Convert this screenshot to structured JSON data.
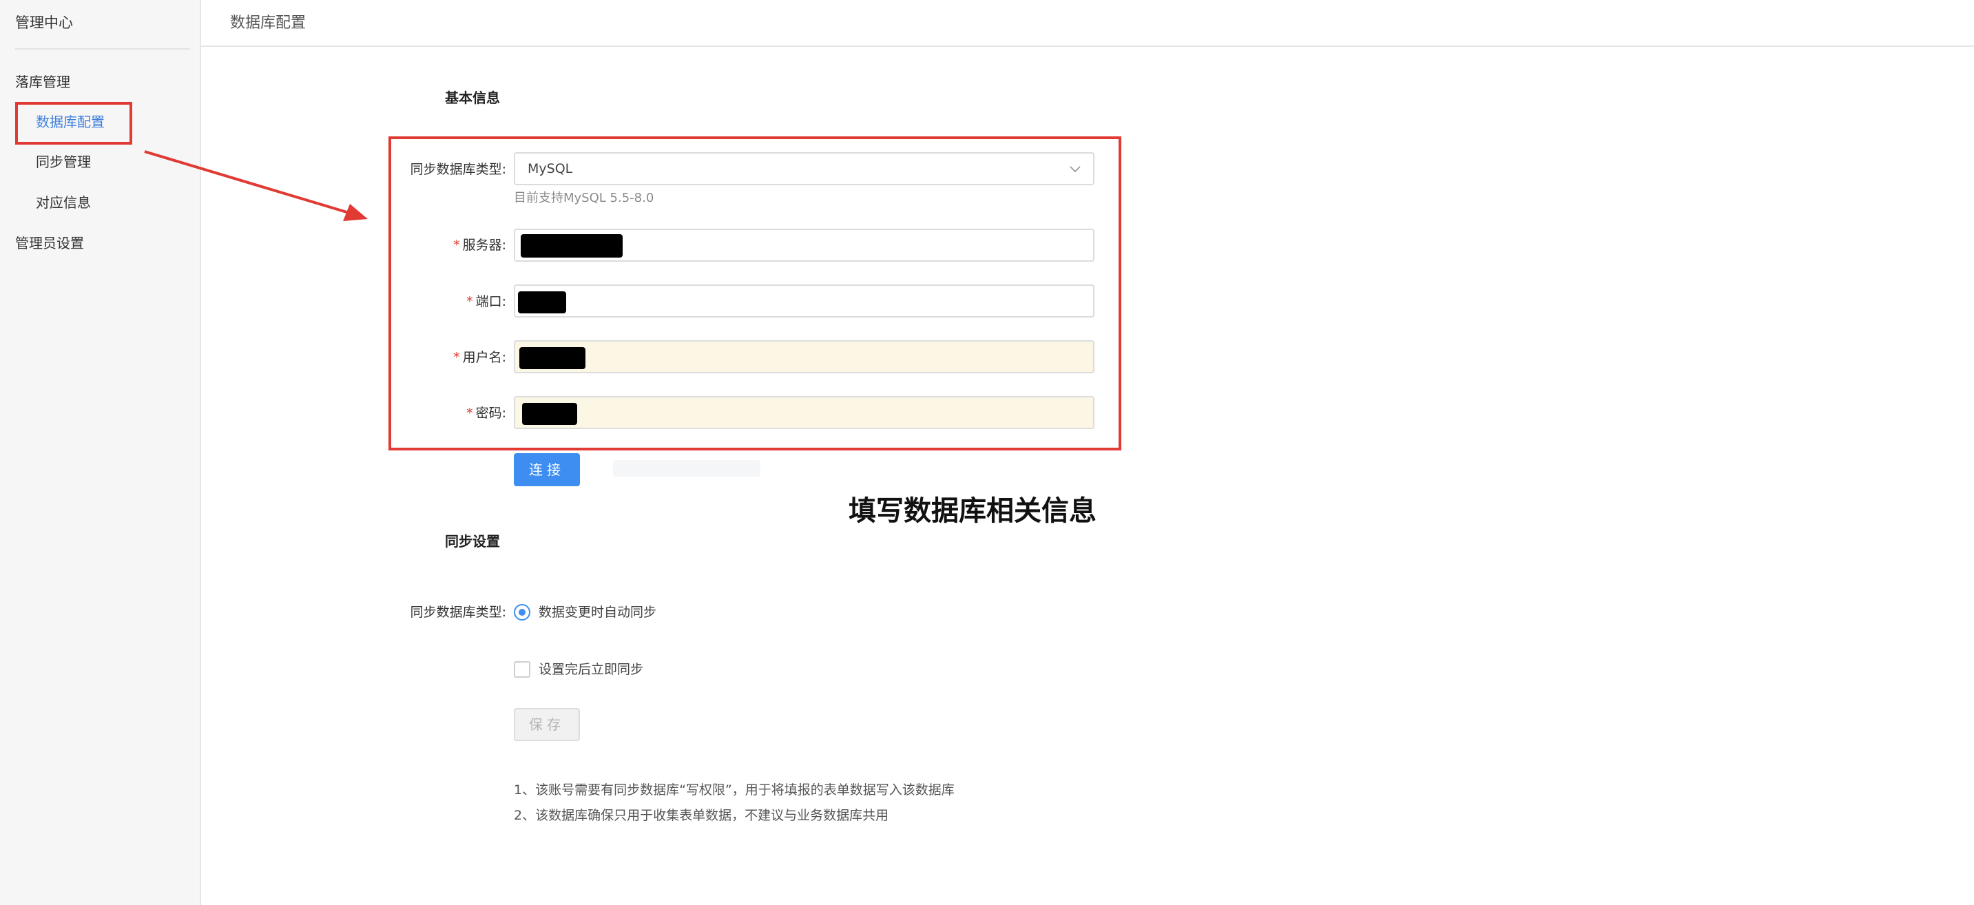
{
  "sidebar": {
    "title": "管理中心",
    "group1": "落库管理",
    "items": [
      {
        "label": "数据库配置",
        "active": true
      },
      {
        "label": "同步管理",
        "active": false
      },
      {
        "label": "对应信息",
        "active": false
      }
    ],
    "group2": "管理员设置"
  },
  "header": {
    "title": "数据库配置"
  },
  "basic_info": {
    "section_title": "基本信息",
    "db_type": {
      "label": "同步数据库类型:",
      "value": "MySQL",
      "hint": "目前支持MySQL 5.5-8.0",
      "icon": "chevron-down-icon"
    },
    "server": {
      "required_mark": "*",
      "label": "服务器:"
    },
    "port": {
      "required_mark": "*",
      "label": "端口:"
    },
    "username": {
      "required_mark": "*",
      "label": "用户名:"
    },
    "password": {
      "required_mark": "*",
      "label": "密码:"
    },
    "connect_button": "连接"
  },
  "annotation": {
    "text": "填写数据库相关信息"
  },
  "sync_settings": {
    "section_title": "同步设置",
    "type_label": "同步数据库类型:",
    "radio_option": "数据变更时自动同步",
    "checkbox_option": "设置完后立即同步",
    "save_button": "保存"
  },
  "notes": [
    "1、该账号需要有同步数据库“写权限”，用于将填报的表单数据写入该数据库",
    "2、该数据库确保只用于收集表单数据，不建议与业务数据库共用"
  ],
  "colors": {
    "accent": "#3d8ef0",
    "highlight": "#e03a33",
    "autofill": "#fcf6e4"
  }
}
